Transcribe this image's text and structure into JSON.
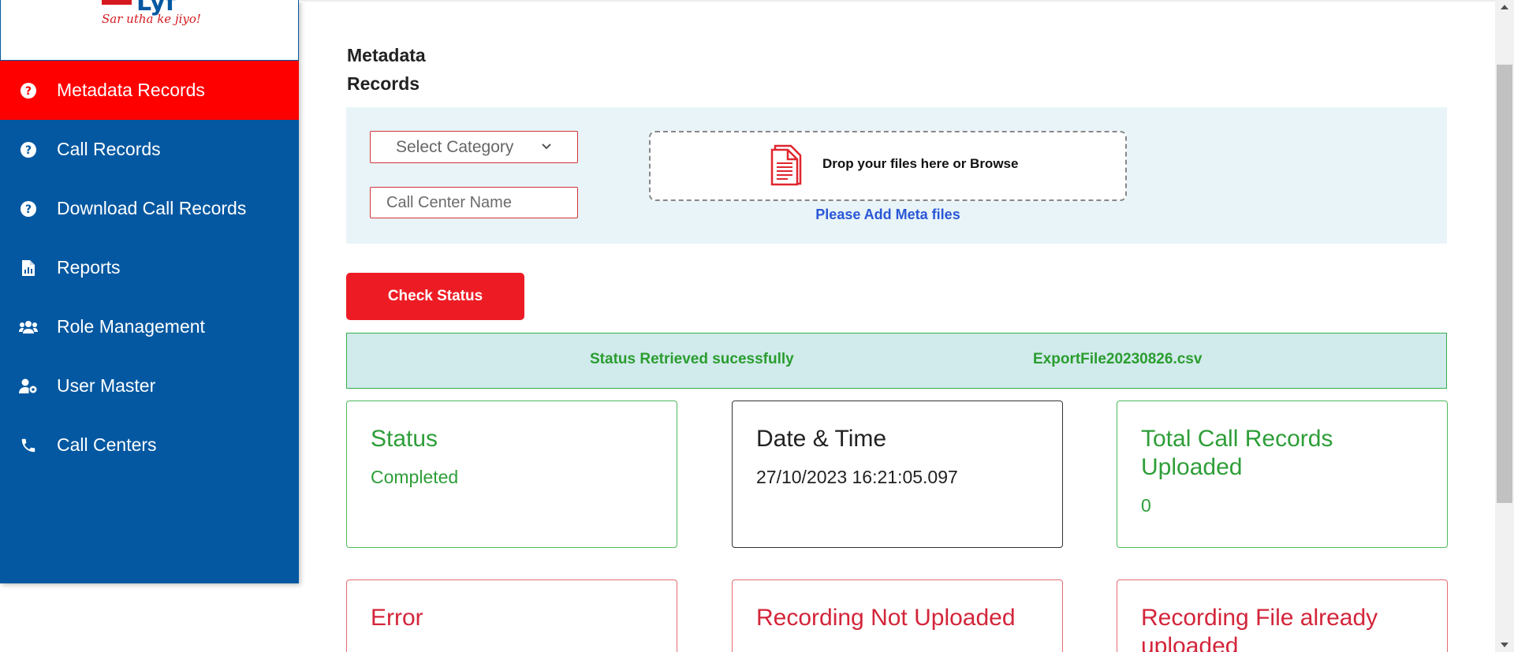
{
  "brand": {
    "wordmark": "Lyf",
    "tagline": "Sar utha ke jiyo!"
  },
  "sidebar": {
    "items": [
      {
        "label": "Metadata Records",
        "icon": "help-circle-icon",
        "active": true
      },
      {
        "label": "Call Records",
        "icon": "help-circle-icon"
      },
      {
        "label": "Download Call Records",
        "icon": "help-circle-icon"
      },
      {
        "label": "Reports",
        "icon": "report-file-icon"
      },
      {
        "label": "Role Management",
        "icon": "users-group-icon"
      },
      {
        "label": "User Master",
        "icon": "user-cog-icon"
      },
      {
        "label": "Call Centers",
        "icon": "phone-icon"
      }
    ]
  },
  "page": {
    "title": "Metadata Records"
  },
  "upload": {
    "category_value": "Select Category",
    "call_center_placeholder": "Call Center Name",
    "dropzone_text": "Drop your files here or Browse",
    "hint": "Please Add Meta files"
  },
  "actions": {
    "check_status_label": "Check Status"
  },
  "status_bar": {
    "message": "Status Retrieved sucessfully",
    "file_name": "ExportFile20230826.csv"
  },
  "cards": {
    "status": {
      "title": "Status",
      "value": "Completed"
    },
    "datetime": {
      "title": "Date & Time",
      "value": "27/10/2023 16:21:05.097"
    },
    "total": {
      "title": "Total Call Records Uploaded",
      "value": "0"
    },
    "error": {
      "title": "Error"
    },
    "not_uploaded": {
      "title": "Recording Not Uploaded"
    },
    "already_uploaded": {
      "title": "Recording File already uploaded"
    }
  },
  "colors": {
    "sidebar": "#0458a1",
    "active": "#ff0000",
    "accent_red": "#ed1c24",
    "success": "#2e9e38",
    "panel": "#e8f4f8"
  }
}
